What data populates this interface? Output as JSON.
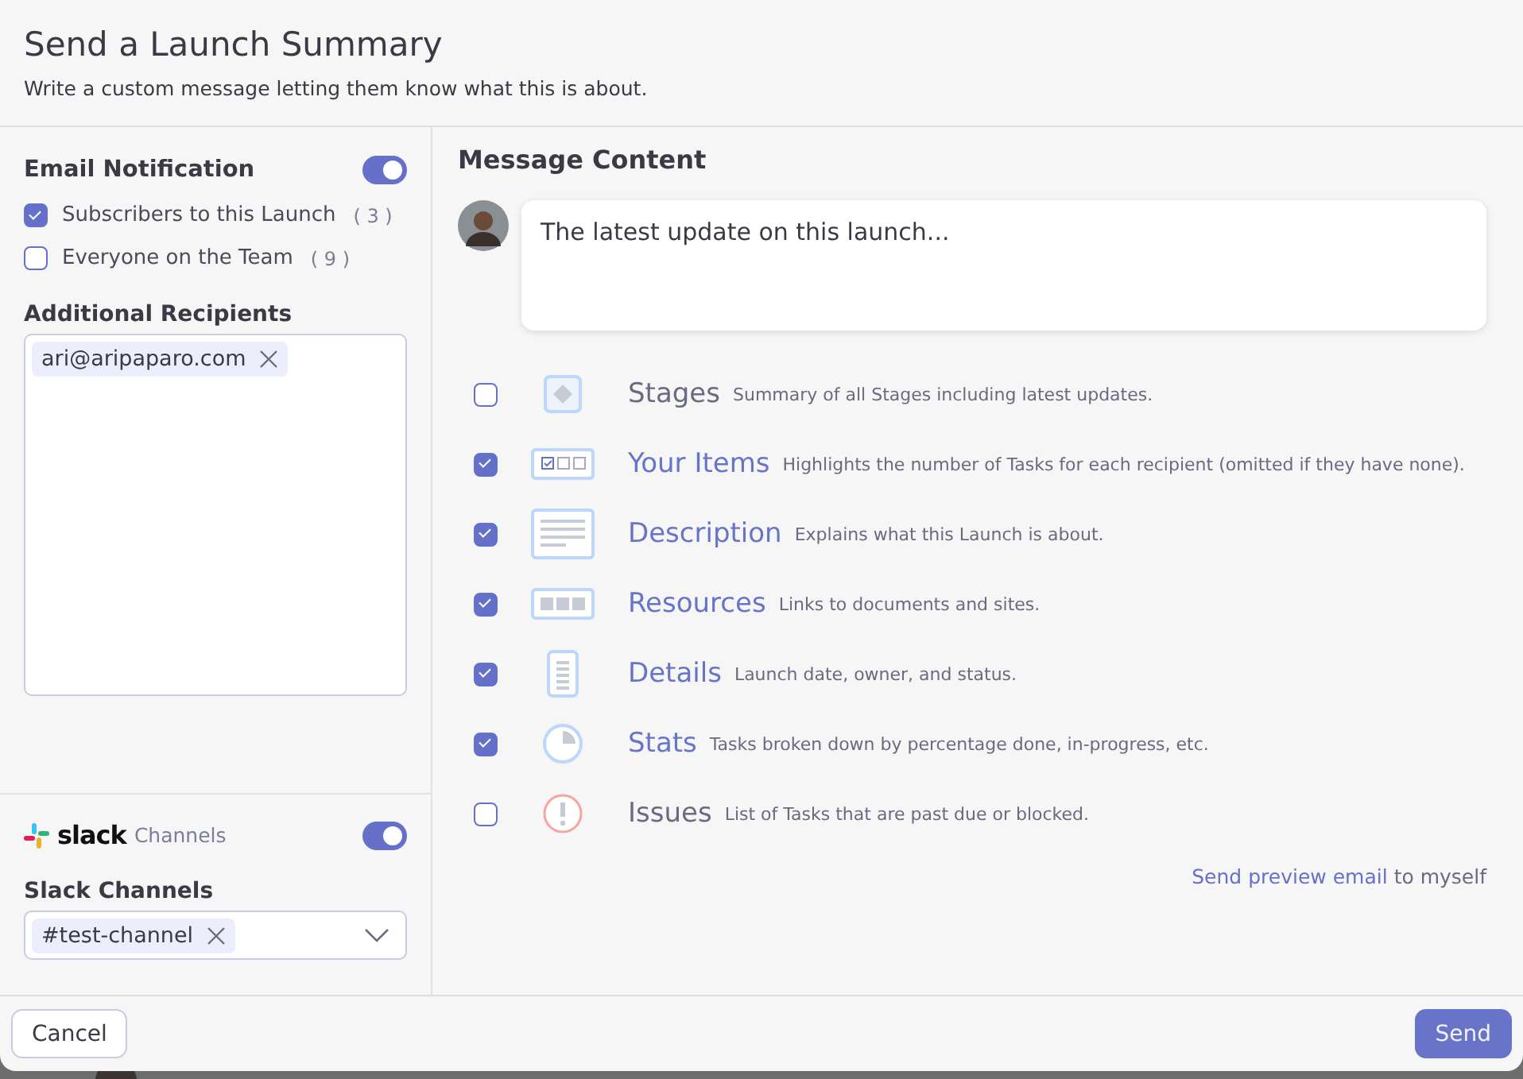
{
  "dialog": {
    "title": "Send a Launch Summary",
    "subtitle": "Write a custom message letting them know what this is about."
  },
  "email": {
    "heading": "Email Notification",
    "on": true,
    "audiences": [
      {
        "label": "Subscribers to this Launch",
        "count": "( 3 )",
        "checked": true
      },
      {
        "label": "Everyone on the Team",
        "count": "( 9 )",
        "checked": false
      }
    ],
    "recipients_label": "Additional Recipients",
    "recipients": [
      "ari@aripaparo.com"
    ]
  },
  "slack": {
    "brand": "slack",
    "suffix": "Channels",
    "on": true,
    "channels_label": "Slack Channels",
    "channels": [
      "#test-channel"
    ]
  },
  "message": {
    "heading": "Message Content",
    "text": "The latest update on this launch...",
    "sections": [
      {
        "title": "Stages",
        "description": "Summary of all Stages including latest updates.",
        "checked": false
      },
      {
        "title": "Your Items",
        "description": "Highlights the number of Tasks for each recipient (omitted if they have none).",
        "checked": true
      },
      {
        "title": "Description",
        "description": "Explains what this Launch is about.",
        "checked": true
      },
      {
        "title": "Resources",
        "description": "Links to documents and sites.",
        "checked": true
      },
      {
        "title": "Details",
        "description": "Launch date, owner, and status.",
        "checked": true
      },
      {
        "title": "Stats",
        "description": "Tasks broken down by percentage done, in-progress, etc.",
        "checked": true
      },
      {
        "title": "Issues",
        "description": "List of Tasks that are past due or blocked.",
        "checked": false
      }
    ],
    "preview_link": "Send preview email",
    "preview_suffix": "to myself"
  },
  "footer": {
    "cancel": "Cancel",
    "send": "Send"
  }
}
